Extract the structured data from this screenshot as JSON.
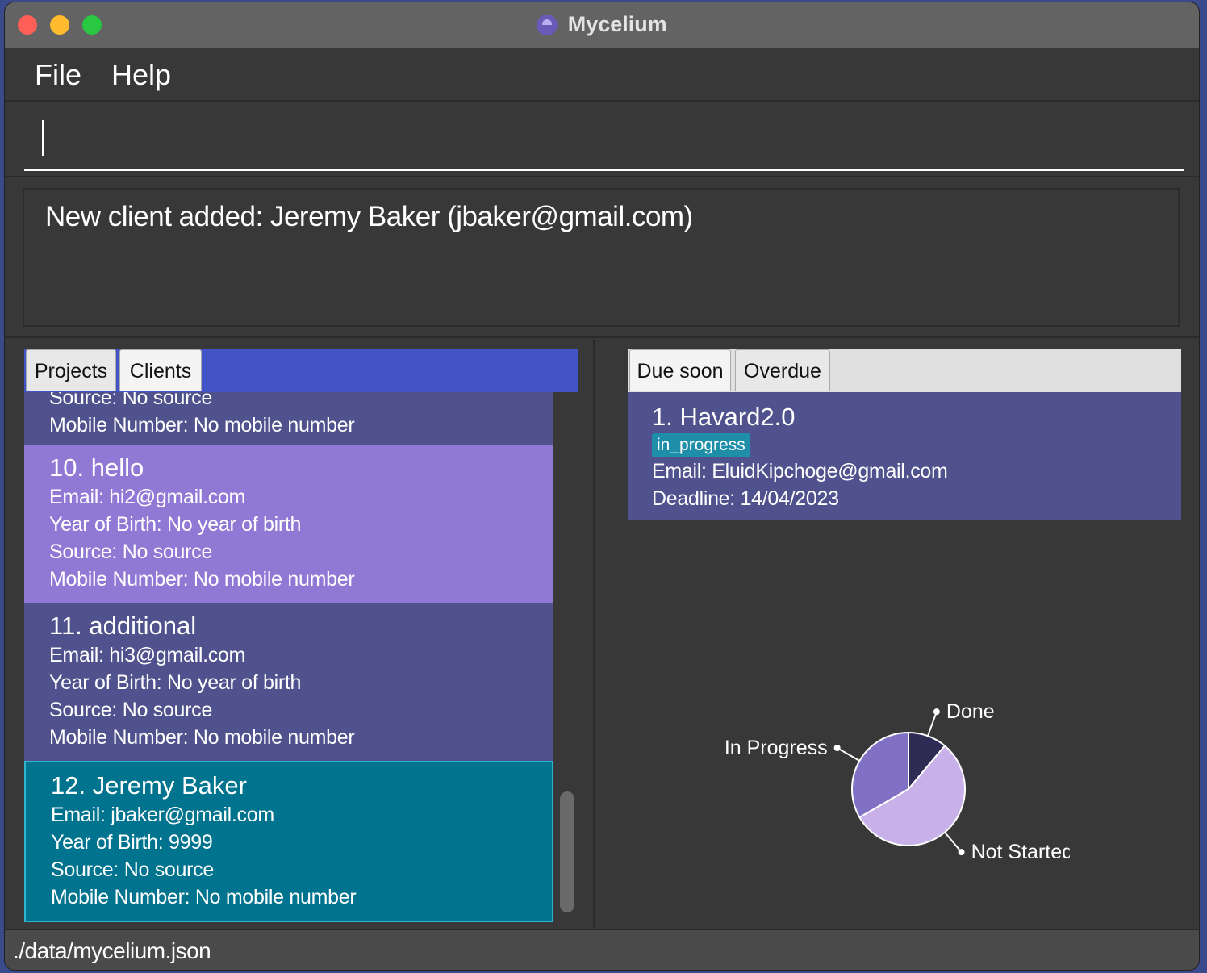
{
  "window": {
    "title": "Mycelium"
  },
  "menu": {
    "file": "File",
    "help": "Help"
  },
  "command": {
    "value": ""
  },
  "result": {
    "text": "New client added: Jeremy Baker (jbaker@gmail.com)"
  },
  "left_tabs": {
    "projects": "Projects",
    "clients": "Clients"
  },
  "clients": [
    {
      "source": "Source: No source",
      "mobile": "Mobile Number: No mobile number"
    },
    {
      "title": "10.  hello",
      "email": "Email: hi2@gmail.com",
      "yob": "Year of Birth: No year of birth",
      "source": "Source: No source",
      "mobile": "Mobile Number: No mobile number"
    },
    {
      "title": "11.  additional",
      "email": "Email: hi3@gmail.com",
      "yob": "Year of Birth: No year of birth",
      "source": "Source: No source",
      "mobile": "Mobile Number: No mobile number"
    },
    {
      "title": "12.  Jeremy Baker",
      "email": "Email: jbaker@gmail.com",
      "yob": "Year of Birth: 9999",
      "source": "Source: No source",
      "mobile": "Mobile Number: No mobile number"
    }
  ],
  "right_tabs": {
    "due_soon": "Due soon",
    "overdue": "Overdue"
  },
  "projects": [
    {
      "title": "1.  Havard2.0",
      "status": "in_progress",
      "email": "Email: EluidKipchoge@gmail.com",
      "deadline": "Deadline: 14/04/2023"
    }
  ],
  "chart_data": {
    "type": "pie",
    "slices": [
      {
        "label": "Done",
        "value": 1,
        "color": "#2e2b55"
      },
      {
        "label": "Not Started",
        "value": 5,
        "color": "#c7b1e8"
      },
      {
        "label": "In Progress",
        "value": 3,
        "color": "#8071c4"
      }
    ]
  },
  "status": {
    "path": "./data/mycelium.json"
  },
  "colors": {
    "background": "#383838",
    "selected_card": "#00748f",
    "highlight_card": "#9079d4",
    "card": "#4f528d",
    "tab_bar": "#4355c6",
    "tag": "#1f8fa9"
  }
}
